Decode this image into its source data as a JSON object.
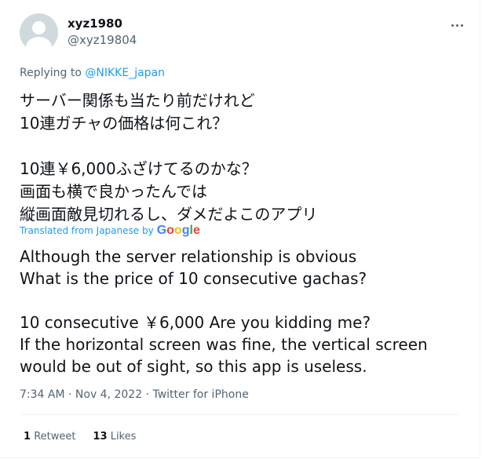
{
  "user": {
    "display_name": "xyz1980",
    "handle": "@xyz19804"
  },
  "reply": {
    "prefix": "Replying to ",
    "mention": "@NIKKE_japan"
  },
  "tweet": {
    "ja_lines": [
      "サーバー関係も当たり前だけれど",
      "10連ガチャの価格は何これ？",
      "",
      "10連￥6,000ふざけてるのかな？",
      "画面も横で良かったんでは",
      "縦画面敵見切れるし、ダメだよこのアプリ"
    ],
    "translated_label": "Translated from Japanese by",
    "translator_logo": "Google",
    "en_lines": [
      "Although the server relationship is obvious",
      "What is the price of 10 consecutive gachas?",
      "",
      "10 consecutive ￥6,000 Are you kidding me?",
      "If the horizontal screen was fine, the vertical screen",
      "would be out of sight, so this app is useless."
    ]
  },
  "meta": {
    "time": "7:34 AM",
    "separator": " · ",
    "date": "Nov 4, 2022",
    "source": "Twitter for iPhone"
  },
  "stats": {
    "retweets_count": "1",
    "retweets_label": "Retweet",
    "likes_count": "13",
    "likes_label": "Likes"
  },
  "icons": {
    "more": "more-horizontal-icon",
    "avatar": "default-profile-avatar"
  },
  "colors": {
    "link": "#1d9bf0",
    "secondary_text": "#536471",
    "primary_text": "#0f1419",
    "avatar_bg": "#cfd9de"
  }
}
